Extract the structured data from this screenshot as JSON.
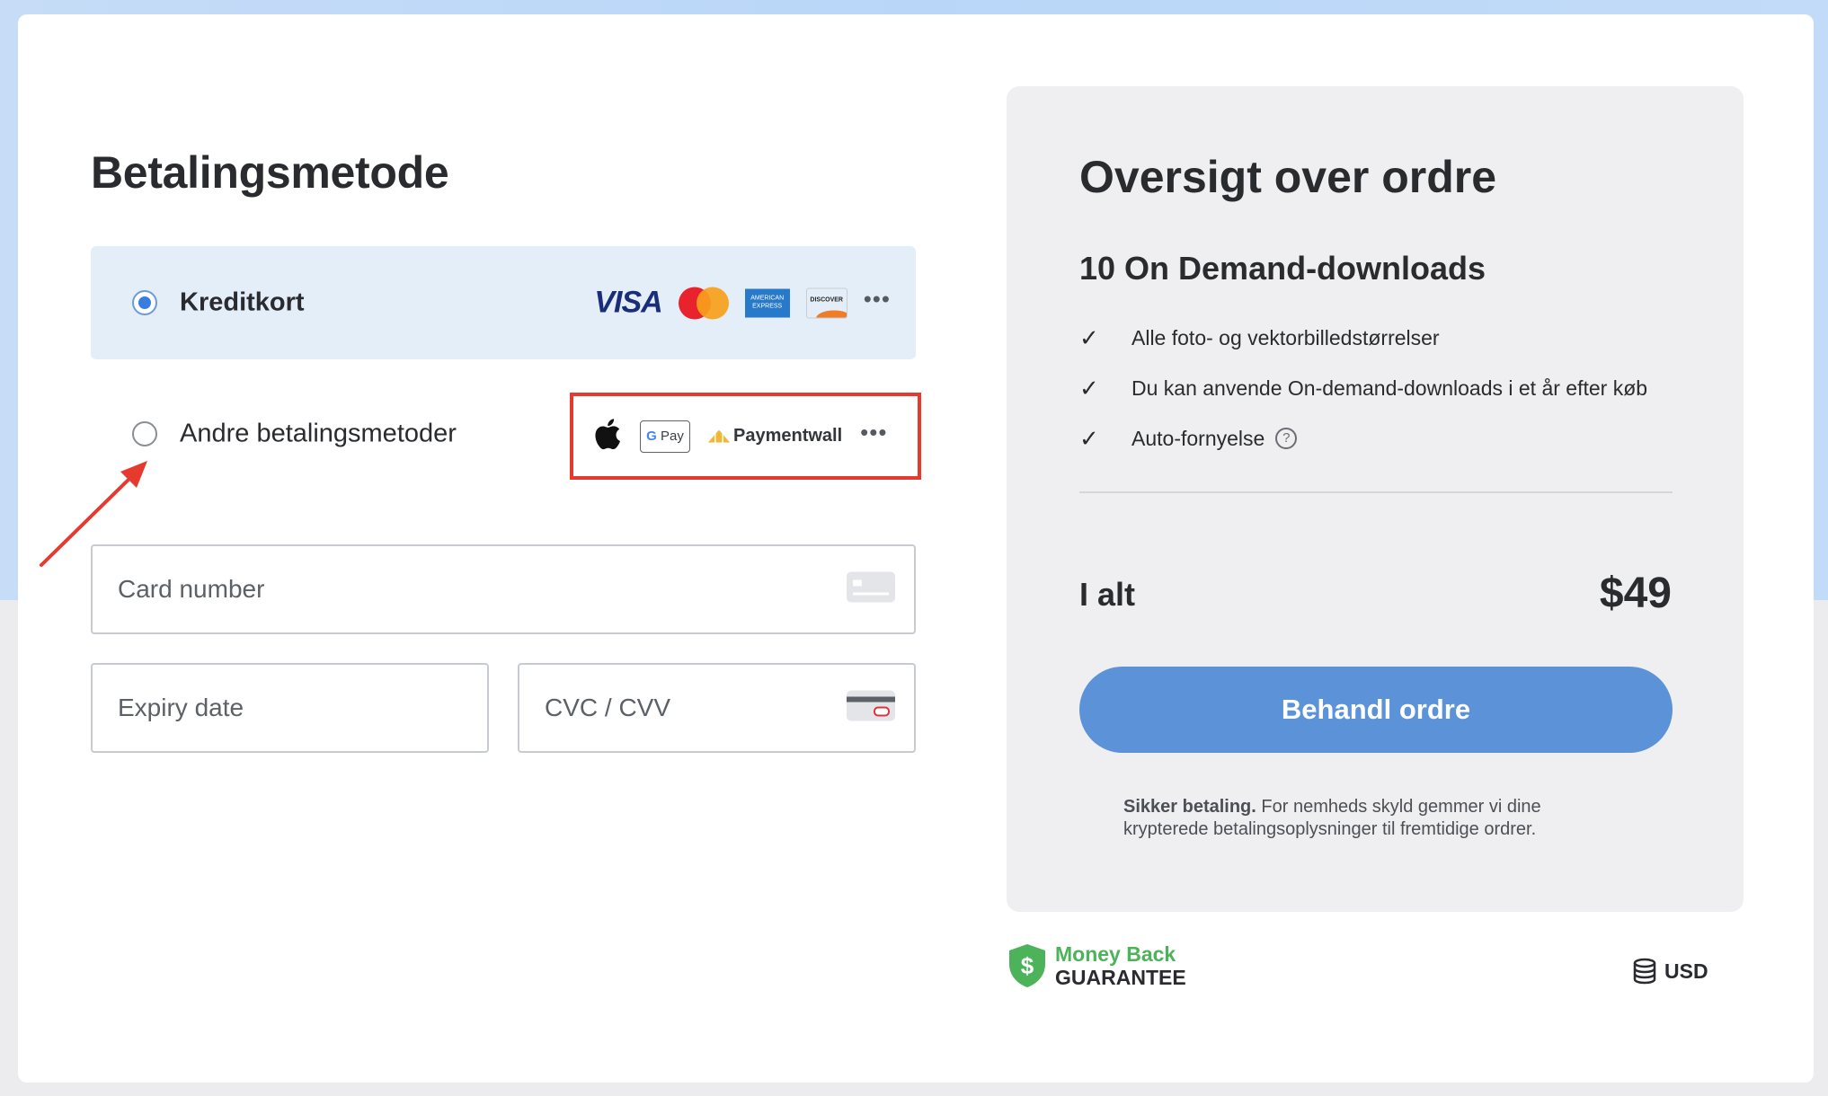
{
  "payment": {
    "title": "Betalingsmetode",
    "methods": [
      {
        "label": "Kreditkort",
        "selected": true,
        "logos": [
          "visa-logo",
          "mastercard-logo",
          "amex-logo",
          "discover-logo",
          "more-icon"
        ]
      },
      {
        "label": "Andre betalingsmetoder",
        "selected": false,
        "logos": [
          "apple-pay-logo",
          "google-pay-logo",
          "paymentwall-logo",
          "more-icon"
        ]
      }
    ],
    "visa_text": "VISA",
    "amex_text": "AMERICAN EXPRESS",
    "discover_text": "DISCOVER",
    "gpay_text": "Pay",
    "gpay_g": "G",
    "paymentwall_text": "Paymentwall",
    "more_text": "•••",
    "fields": {
      "card_number": "Card number",
      "expiry": "Expiry date",
      "cvc": "CVC / CVV"
    },
    "annotation_color": "#e63a2e"
  },
  "summary": {
    "title": "Oversigt over ordre",
    "product": "10 On Demand-downloads",
    "features": [
      "Alle foto- og vektorbilledstørrelser",
      "Du kan anvende On-demand-downloads i et år efter køb",
      "Auto-fornyelse"
    ],
    "check_glyph": "✓",
    "help_glyph": "?",
    "total_label": "I alt",
    "total_value": "$49",
    "cta_label": "Behandl ordre",
    "cta_color": "#5b92d8",
    "secure_bold": "Sikker betaling.",
    "secure_text": " For nemheds skyld gemmer vi dine krypterede betalingsoplysninger til fremtidige ordrer."
  },
  "footer": {
    "guarantee_line1": "Money Back",
    "guarantee_line2": "GUARANTEE",
    "dollar": "$",
    "currency": "USD"
  }
}
